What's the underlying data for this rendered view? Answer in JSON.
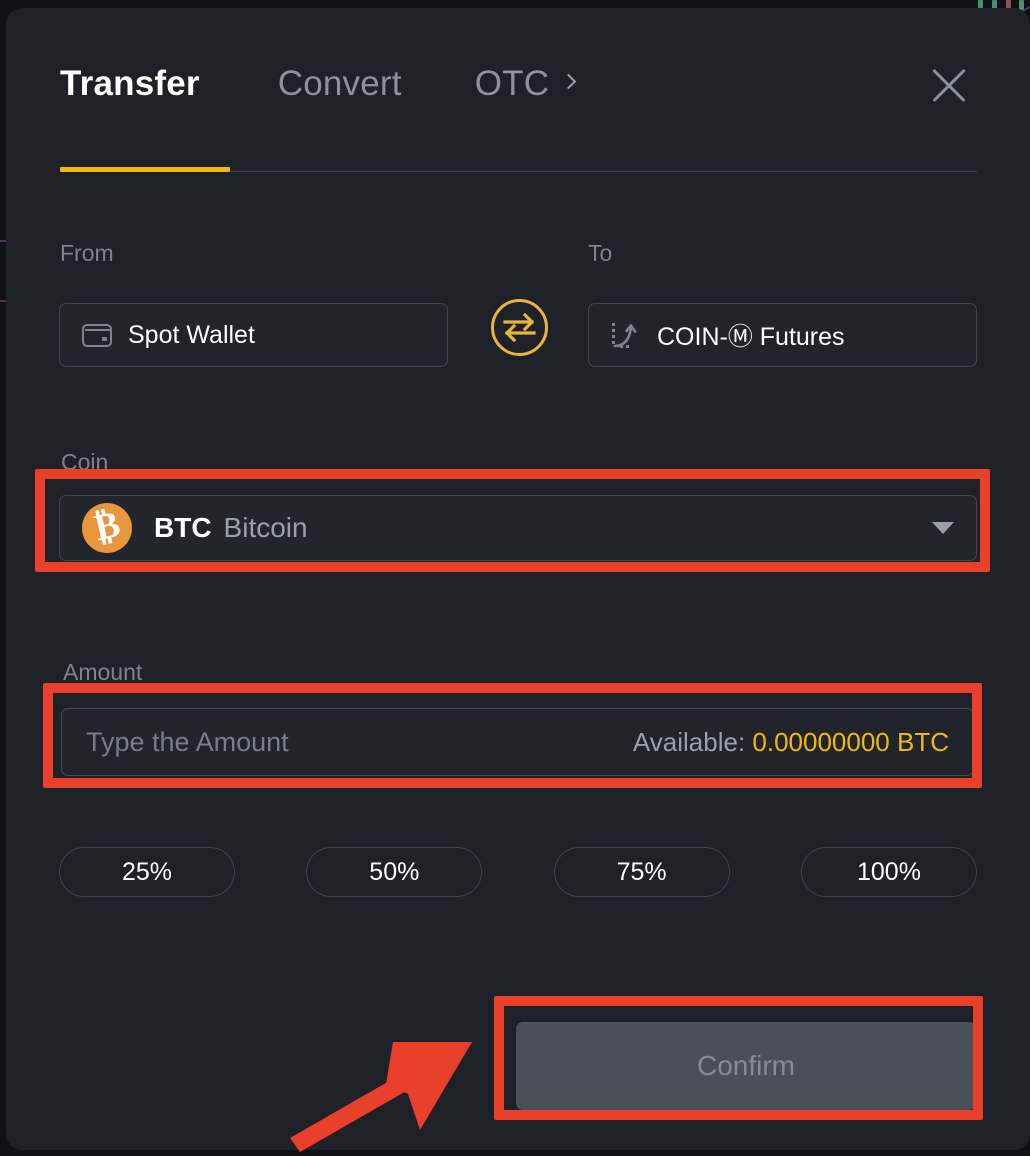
{
  "modal": {
    "name": "transfer-dialog",
    "close_icon": "close-icon",
    "accent_yellow": "#F0B90B",
    "panel_bg": "#1E2127",
    "annotation_red": "#E8402A"
  },
  "tabs": [
    {
      "label": "Transfer",
      "active": true
    },
    {
      "label": "Convert",
      "active": false
    },
    {
      "label": "OTC",
      "active": false,
      "trailing_icon": "chevron-right-icon"
    }
  ],
  "transfer": {
    "from_label": "From",
    "from_value": "Spot Wallet",
    "from_icon": "wallet-icon",
    "to_label": "To",
    "to_value": "COIN-Ⓜ Futures",
    "to_icon": "futures-chart-icon",
    "swap_icon": "swap-arrows-icon"
  },
  "coin": {
    "label": "Coin",
    "symbol": "BTC",
    "name": "Bitcoin",
    "icon": "bitcoin-icon",
    "icon_color": "#E8973E",
    "glyph": "₿",
    "dropdown_icon": "caret-down-icon"
  },
  "amount": {
    "label": "Amount",
    "placeholder": "Type the Amount",
    "value": "",
    "available_label": "Available:",
    "available_value": "0.00000000 BTC"
  },
  "percent_buttons": [
    {
      "label": "25%"
    },
    {
      "label": "50%"
    },
    {
      "label": "75%"
    },
    {
      "label": "100%"
    }
  ],
  "confirm": {
    "label": "Confirm",
    "disabled": true
  },
  "annotations": {
    "highlight_coin": "coin-selector-highlight",
    "highlight_amount": "amount-input-highlight",
    "highlight_confirm": "confirm-button-highlight",
    "arrow": "pointer-arrow"
  }
}
